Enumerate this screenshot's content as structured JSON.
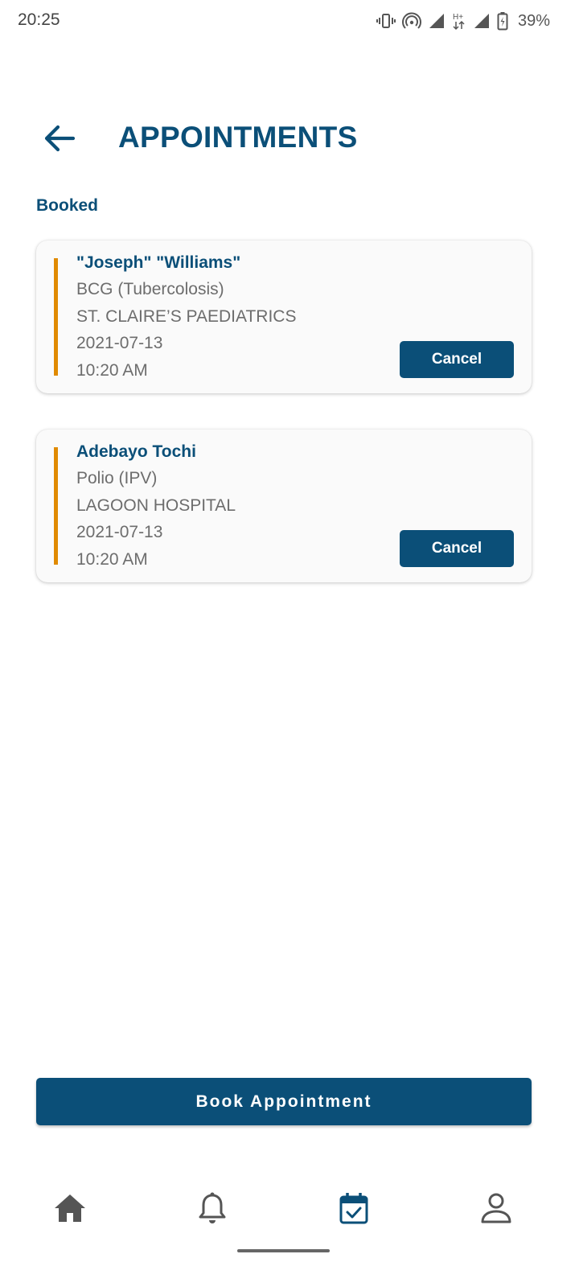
{
  "status_bar": {
    "time": "20:25",
    "battery": "39%"
  },
  "header": {
    "title": "APPOINTMENTS"
  },
  "section": {
    "label": "Booked"
  },
  "appointments": [
    {
      "name": "\"Joseph\" \"Williams\"",
      "vaccine": "BCG (Tubercolosis)",
      "hospital": "ST. CLAIRE’S PAEDIATRICS",
      "date": "2021-07-13",
      "time": "10:20 AM",
      "cancel_label": "Cancel"
    },
    {
      "name": "Adebayo Tochi",
      "vaccine": "Polio (IPV)",
      "hospital": "LAGOON HOSPITAL",
      "date": "2021-07-13",
      "time": "10:20 AM",
      "cancel_label": "Cancel"
    }
  ],
  "book_button": {
    "label": "Book Appointment"
  },
  "bottom_nav": {
    "items": [
      {
        "icon": "home-icon",
        "active": false
      },
      {
        "icon": "bell-icon",
        "active": false
      },
      {
        "icon": "calendar-check-icon",
        "active": true
      },
      {
        "icon": "profile-icon",
        "active": false
      }
    ]
  },
  "colors": {
    "primary": "#0b4f78",
    "accent": "#e08a00",
    "muted_text": "#6d6d6d",
    "inactive_icon": "#555555"
  }
}
